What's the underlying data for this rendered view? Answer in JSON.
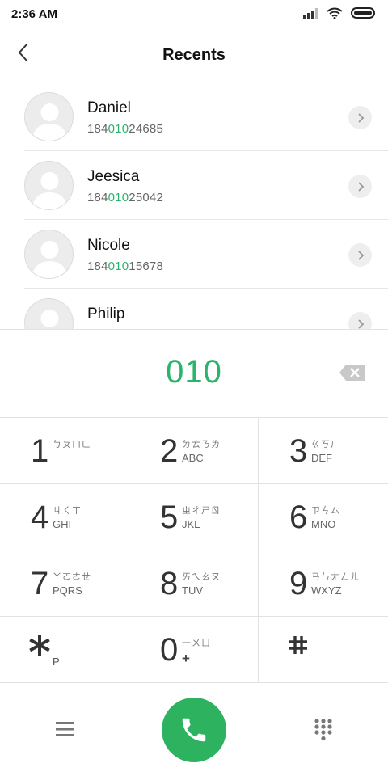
{
  "status_bar": {
    "time": "2:36 AM",
    "icons": [
      "signal-icon",
      "wifi-icon",
      "battery-icon"
    ]
  },
  "header": {
    "title": "Recents",
    "back_icon": "chevron-left-icon"
  },
  "recents": [
    {
      "name": "Daniel",
      "number_prefix": "184",
      "number_match": "010",
      "number_suffix": "24685"
    },
    {
      "name": "Jeesica",
      "number_prefix": "184",
      "number_match": "010",
      "number_suffix": "25042"
    },
    {
      "name": "Nicole",
      "number_prefix": "184",
      "number_match": "010",
      "number_suffix": "15678"
    },
    {
      "name": "Philip",
      "number_prefix": "",
      "number_match": "",
      "number_suffix": ""
    }
  ],
  "dialer": {
    "dialed_number": "010",
    "backspace_icon": "backspace-icon"
  },
  "keypad": {
    "keys": [
      {
        "digit": "1",
        "bopomofo": "ㄅㄆㄇㄈ",
        "letters": ""
      },
      {
        "digit": "2",
        "bopomofo": "ㄉㄊㄋㄌ",
        "letters": "ABC"
      },
      {
        "digit": "3",
        "bopomofo": "ㄍㄎㄏ",
        "letters": "DEF"
      },
      {
        "digit": "4",
        "bopomofo": "ㄐㄑㄒ",
        "letters": "GHI"
      },
      {
        "digit": "5",
        "bopomofo": "ㄓㄔㄕㄖ",
        "letters": "JKL"
      },
      {
        "digit": "6",
        "bopomofo": "ㄗㄘㄙ",
        "letters": "MNO"
      },
      {
        "digit": "7",
        "bopomofo": "ㄚㄛㄜㄝ",
        "letters": "PQRS"
      },
      {
        "digit": "8",
        "bopomofo": "ㄞㄟㄠㄡ",
        "letters": "TUV"
      },
      {
        "digit": "9",
        "bopomofo": "ㄢㄣㄤㄥㄦ",
        "letters": "WXYZ"
      },
      {
        "digit": "*",
        "bopomofo": "",
        "letters": "P"
      },
      {
        "digit": "0",
        "bopomofo": "一ㄨㄩ",
        "letters": "+"
      },
      {
        "digit": "#",
        "bopomofo": "",
        "letters": ""
      }
    ]
  },
  "bottom_bar": {
    "menu_icon": "menu-icon",
    "call_icon": "phone-icon",
    "keypad_icon": "dialpad-icon"
  },
  "colors": {
    "accent": "#2cb36b",
    "call_button": "#2db35f"
  }
}
